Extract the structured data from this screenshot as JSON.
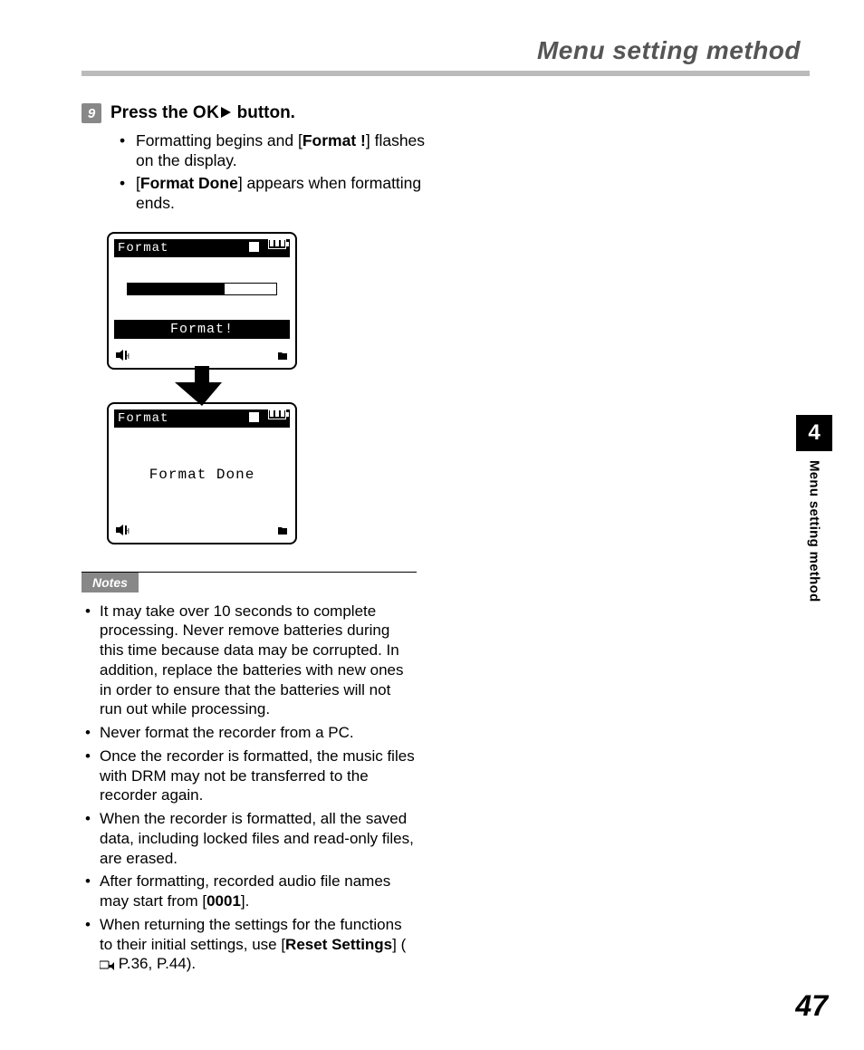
{
  "header": {
    "running_title": "Menu setting method"
  },
  "step": {
    "number": "9",
    "prefix": "Press the ",
    "ok": "OK",
    "suffix": " button."
  },
  "step_bullets": {
    "b1_a": "Formatting begins and [",
    "b1_bold": "Format !",
    "b1_b": "] flashes on the display.",
    "b2_a": "[",
    "b2_bold": "Format Done",
    "b2_b": "] appears when formatting ends."
  },
  "lcd": {
    "title": "Format",
    "flash": "Format!",
    "done": "Format Done"
  },
  "notes": {
    "label": "Notes",
    "n1": "It may take over 10 seconds to complete processing. Never remove batteries during this time because data may be corrupted. In addition, replace the batteries with new ones in order to ensure that the batteries will not run out while processing.",
    "n2": "Never format the recorder from a PC.",
    "n3": "Once the recorder is formatted, the music files with DRM may not be transferred to the recorder again.",
    "n4": "When the recorder is formatted, all the saved data, including locked files and read-only files, are erased.",
    "n5_a": "After formatting, recorded audio file names may start from [",
    "n5_bold": "0001",
    "n5_b": "].",
    "n6_a": "When returning the settings for the functions to their initial settings, use [",
    "n6_bold": "Reset Settings",
    "n6_b": "] (",
    "n6_pages": " P.36, P.44)."
  },
  "side": {
    "chapter": "4",
    "label": "Menu setting method"
  },
  "page_number": "47"
}
